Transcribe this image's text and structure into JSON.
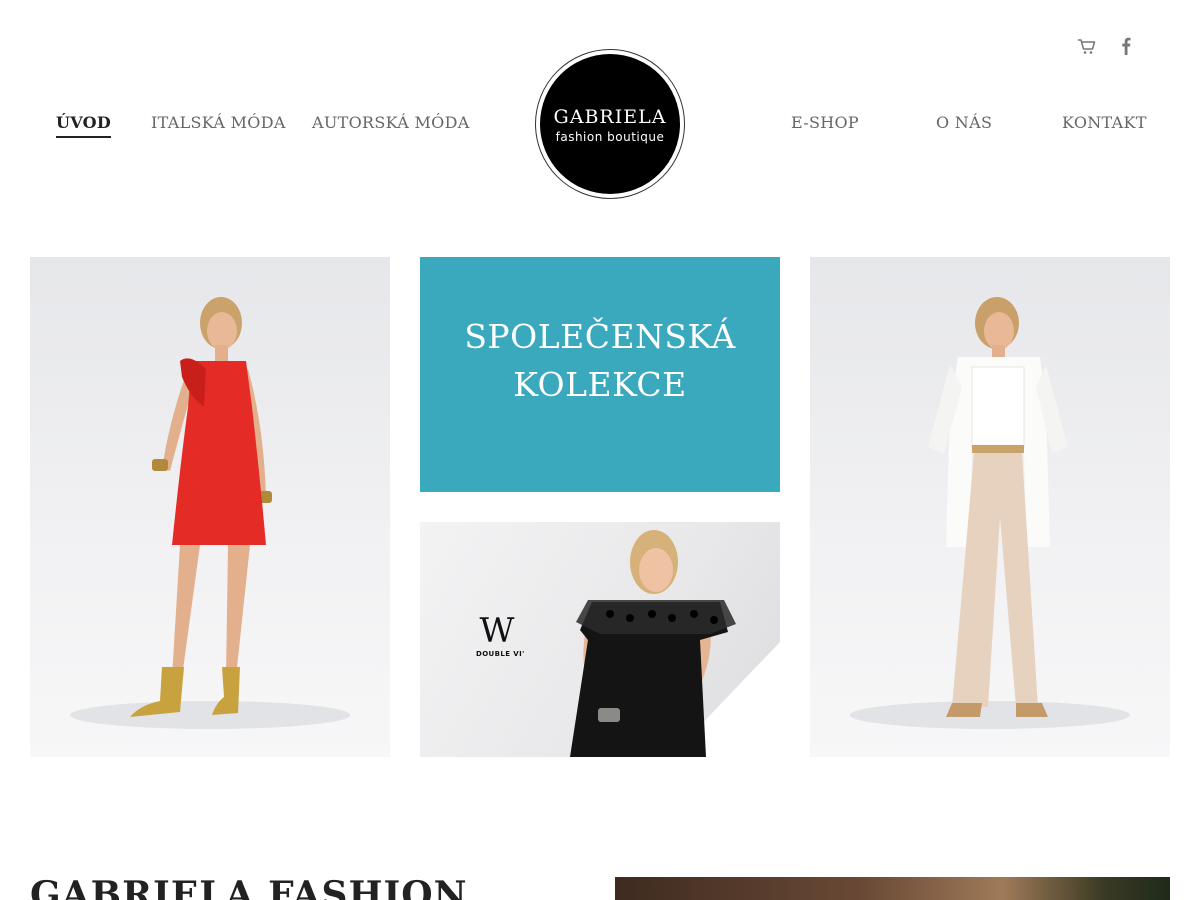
{
  "nav": {
    "left": [
      {
        "label": "ÚVOD",
        "active": true
      },
      {
        "label": "ITALSKÁ MÓDA",
        "active": false
      },
      {
        "label": "AUTORSKÁ MÓDA",
        "active": false
      }
    ],
    "right": [
      {
        "label": "E-SHOP"
      },
      {
        "label": "O NÁS"
      },
      {
        "label": "KONTAKT"
      }
    ]
  },
  "logo": {
    "name": "GABRIELA",
    "tagline": "fashion boutique"
  },
  "header_icons": [
    {
      "name": "cart-icon"
    },
    {
      "name": "facebook-icon"
    }
  ],
  "tiles": {
    "promo": {
      "line1": "SPOLEČENSKÁ",
      "line2": "KOLEKCE",
      "color": "#3aa8bd"
    },
    "brand": {
      "mark": "W",
      "sub": "DOUBLE VI'"
    }
  },
  "section": {
    "title": "GABRIELA FASHION"
  },
  "colors": {
    "accent": "#3aa8bd",
    "text": "#666666",
    "active": "#222222",
    "logo_bg": "#000000"
  }
}
